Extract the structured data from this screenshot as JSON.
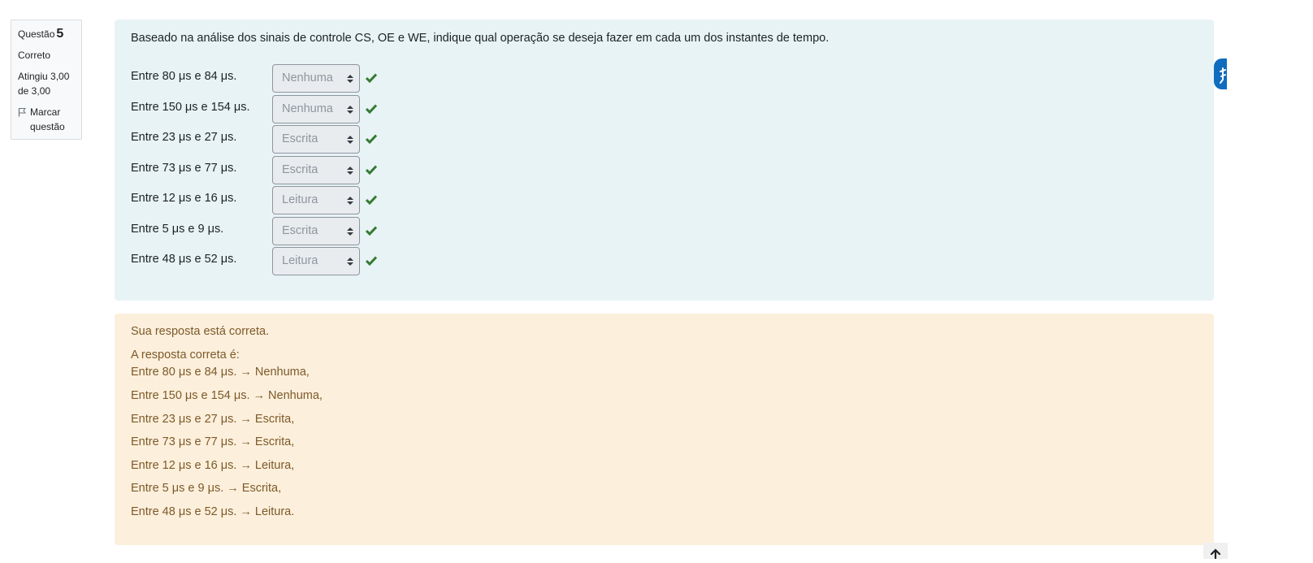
{
  "question_info": {
    "label": "Questão",
    "number": "5",
    "state": "Correto",
    "grade": "Atingiu 3,00 de 3,00",
    "flag_label": "Marcar questão"
  },
  "question": {
    "text": "Baseado na análise dos sinais de controle CS, OE e WE, indique qual operação se deseja fazer em cada um dos instantes de tempo.",
    "rows": [
      {
        "label": "Entre 80 μs e 84 μs.",
        "selected": "Nenhuma"
      },
      {
        "label": "Entre 150 μs e 154 μs.",
        "selected": "Nenhuma"
      },
      {
        "label": "Entre 23 μs e 27 μs.",
        "selected": "Escrita"
      },
      {
        "label": "Entre 73 μs e 77 μs.",
        "selected": "Escrita"
      },
      {
        "label": "Entre 12 μs e 16 μs.",
        "selected": "Leitura"
      },
      {
        "label": "Entre 5 μs e 9 μs.",
        "selected": "Escrita"
      },
      {
        "label": "Entre 48 μs e 52 μs.",
        "selected": "Leitura"
      }
    ]
  },
  "feedback": {
    "status": "Sua resposta está correta.",
    "answer_intro": "A resposta correta é:",
    "answers": [
      "Entre 80 μs e 84 μs. → Nenhuma,",
      "Entre 150 μs e 154 μs. → Nenhuma,",
      "Entre 23 μs e 27 μs. → Escrita,",
      "Entre 73 μs e 77 μs. → Escrita,",
      "Entre 12 μs e 16 μs. → Leitura,",
      "Entre 5 μs e 9 μs. → Escrita,",
      "Entre 48 μs e 52 μs. → Leitura."
    ]
  },
  "icons": {
    "check": "check-icon",
    "flag": "flag-icon",
    "caret": "select-caret-icon",
    "side_tab": "accessibility-icon",
    "back_to_top": "arrow-up-icon"
  },
  "colors": {
    "formulation_bg": "#e7f3f5",
    "feedback_bg": "#fcefdc",
    "feedback_text": "#7d5a29",
    "check": "#357a32",
    "accent": "#0f6cbf"
  }
}
